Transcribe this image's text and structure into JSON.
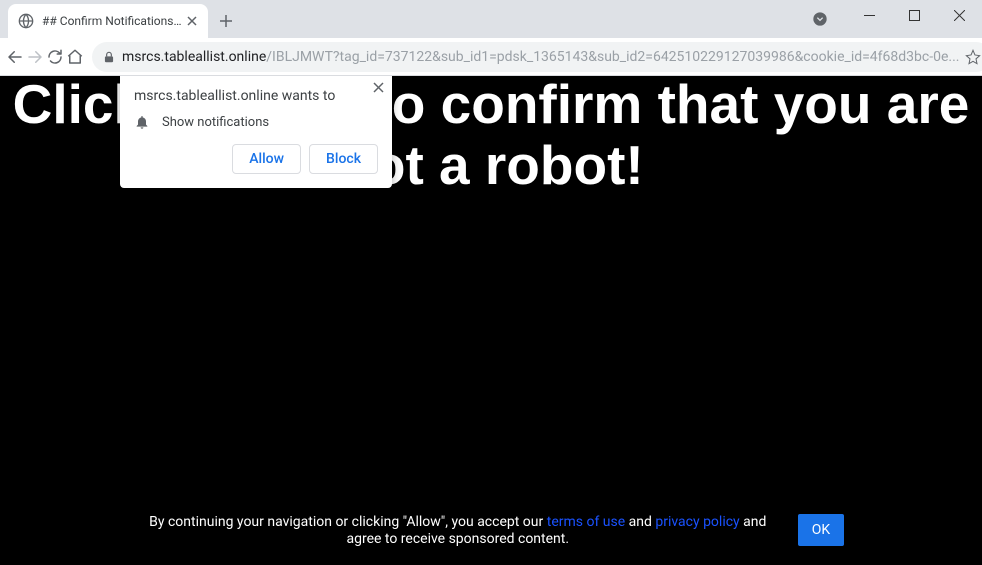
{
  "window": {
    "tab_title": "## Confirm Notifications ##"
  },
  "toolbar": {
    "url_host": "msrcs.tableallist.online",
    "url_path": "/IBLJMWT?tag_id=737122&sub_id1=pdsk_1365143&sub_id2=642510229127039986&cookie_id=4f68d3bc-0e..."
  },
  "permission": {
    "origin_text": "msrcs.tableallist.online wants to",
    "show_notifications": "Show notifications",
    "allow": "Allow",
    "block": "Block"
  },
  "page": {
    "headline": "Click \"Allow\" to confirm that you are not a robot!"
  },
  "consent": {
    "prefix": "By continuing your navigation or clicking \"Allow\", you accept our ",
    "terms": "terms of use",
    "and": " and ",
    "privacy": "privacy policy",
    "suffix": " and agree to receive sponsored content.",
    "ok": "OK"
  }
}
